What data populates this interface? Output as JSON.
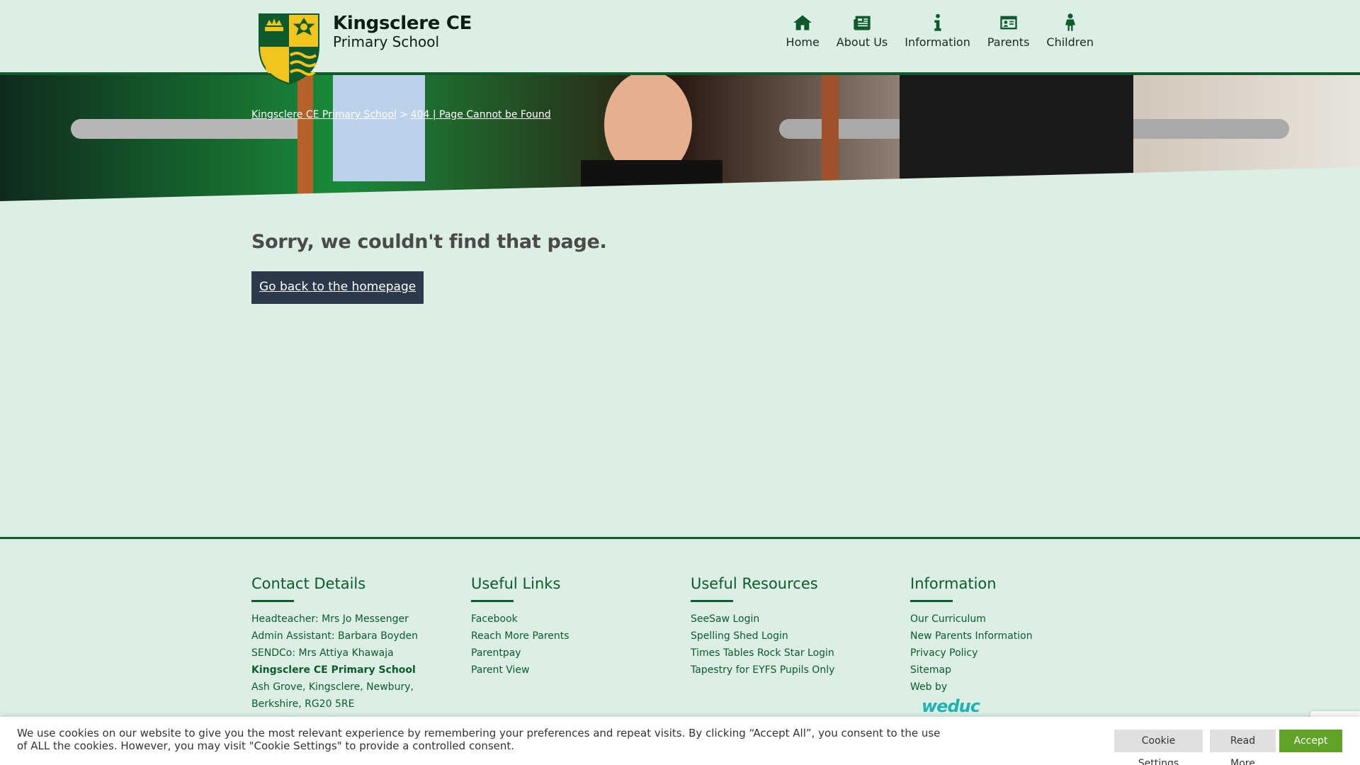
{
  "header": {
    "school_name": "Kingsclere CE",
    "school_sub": "Primary School",
    "nav": [
      {
        "label": "Home",
        "icon": "home-icon"
      },
      {
        "label": "About Us",
        "icon": "newspaper-icon"
      },
      {
        "label": "Information",
        "icon": "info-icon"
      },
      {
        "label": "Parents",
        "icon": "id-card-icon"
      },
      {
        "label": "Children",
        "icon": "child-icon"
      }
    ]
  },
  "breadcrumb": {
    "home": "Kingsclere CE Primary School",
    "separator": ">",
    "current": "404 | Page Cannot be Found"
  },
  "main": {
    "title": "Sorry, we couldn't find that page.",
    "button": "Go back to the homepage"
  },
  "footer": {
    "contact": {
      "heading": "Contact Details",
      "lines": [
        "Headteacher: Mrs Jo Messenger",
        "Admin Assistant: Barbara Boyden",
        "SENDCo: Mrs Attiya Khawaja",
        "Kingsclere CE Primary School",
        "Ash Grove, Kingsclere, Newbury,",
        "Berkshire, RG20 5RE"
      ]
    },
    "useful_links": {
      "heading": "Useful Links",
      "links": [
        "Facebook",
        "Reach More Parents",
        "Parentpay",
        "Parent View"
      ]
    },
    "useful_resources": {
      "heading": "Useful Resources",
      "links": [
        "SeeSaw Login",
        "Spelling Shed Login",
        "Times Tables Rock Star Login",
        "Tapestry for EYFS Pupils Only"
      ]
    },
    "information": {
      "heading": "Information",
      "links": [
        "Our Curriculum",
        "New Parents Information",
        "Privacy Policy",
        "Sitemap",
        "Web by"
      ],
      "logo_text": "weduc"
    }
  },
  "cookie": {
    "text": "We use cookies on our website to give you the most relevant experience by remembering your preferences and repeat visits. By clicking “Accept All”, you consent to the use of ALL the cookies. However, you may visit \"Cookie Settings\" to provide a controlled consent.",
    "settings": "Cookie Settings",
    "read_more": "Read More",
    "accept": "Accept All"
  },
  "colors": {
    "brand_green": "#0d5a2c",
    "page_bg": "#dcefe5",
    "button_dark": "#2a3a4a",
    "accept_green": "#61a229",
    "crest_yellow": "#f2c51e"
  }
}
